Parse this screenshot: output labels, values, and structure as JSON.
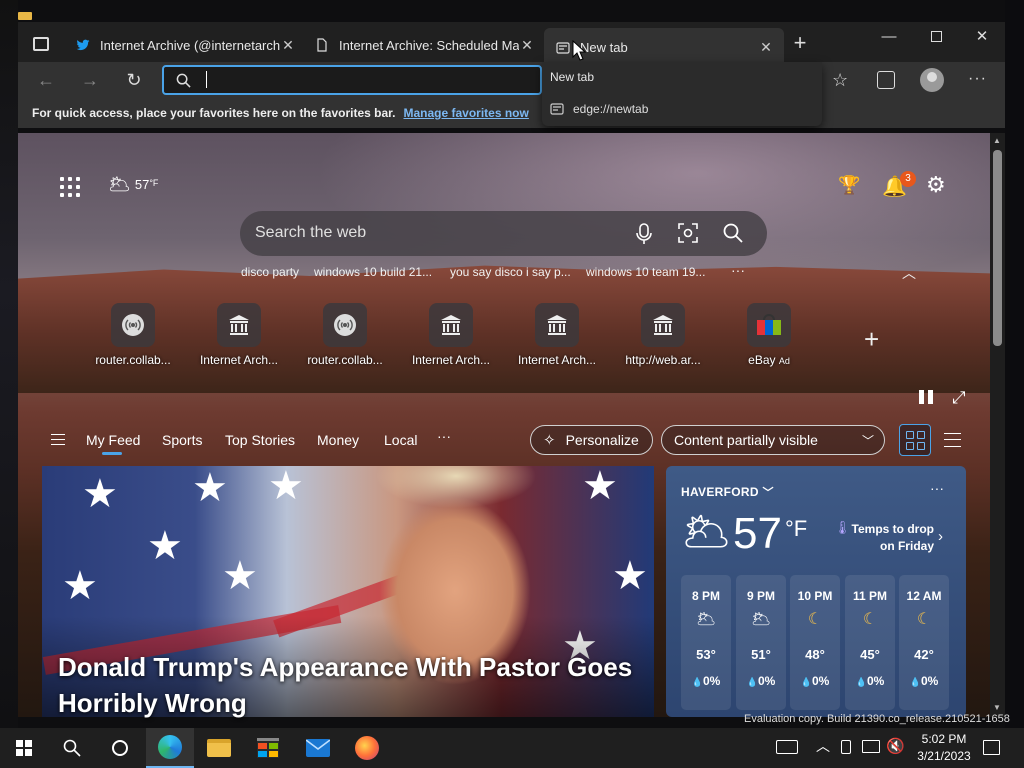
{
  "browser": {
    "tabs": [
      {
        "title": "Internet Archive (@internetarchive",
        "icon": "twitter-icon",
        "active": false
      },
      {
        "title": "Internet Archive: Scheduled Main",
        "icon": "document-icon",
        "active": false
      },
      {
        "title": "New tab",
        "icon": "newtab-icon",
        "active": true
      }
    ],
    "address": {
      "value": "",
      "placeholder": ""
    },
    "favorites_bar": {
      "text": "For quick access, place your favorites here on the favorites bar.",
      "link": "Manage favorites now"
    },
    "dropdown": {
      "title": "New tab",
      "item": "edge://newtab"
    }
  },
  "newtab": {
    "weather_temp": "57",
    "weather_unit": "°F",
    "notifications": "3",
    "search_placeholder": "Search the web",
    "suggestions": [
      "disco party",
      "windows 10 build 21...",
      "you say disco i say p...",
      "windows 10 team 19..."
    ],
    "more": "···",
    "tiles": [
      {
        "label": "router.collab...",
        "icon": "router-icon"
      },
      {
        "label": "Internet Arch...",
        "icon": "archive-icon"
      },
      {
        "label": "router.collab...",
        "icon": "router-icon"
      },
      {
        "label": "Internet Arch...",
        "icon": "archive-icon"
      },
      {
        "label": "Internet Arch...",
        "icon": "archive-icon"
      },
      {
        "label": "http://web.ar...",
        "icon": "archive-icon"
      },
      {
        "label": "eBay",
        "ad": "Ad",
        "icon": "ebay-icon"
      }
    ],
    "feed_tabs": [
      "My Feed",
      "Sports",
      "Top Stories",
      "Money",
      "Local"
    ],
    "personalize": "Personalize",
    "content_visibility": "Content partially visible",
    "hero_headline": "Donald Trump's Appearance With Pastor Goes Horribly Wrong",
    "weather_card": {
      "location": "HAVERFORD",
      "temp": "57",
      "unit": "°F",
      "note": "Temps to drop on Friday",
      "hours": [
        {
          "time": "8 PM",
          "temp": "53°",
          "precip": "0%",
          "icon": "partly-cloudy-night-icon"
        },
        {
          "time": "9 PM",
          "temp": "51°",
          "precip": "0%",
          "icon": "partly-cloudy-night-icon"
        },
        {
          "time": "10 PM",
          "temp": "48°",
          "precip": "0%",
          "icon": "moon-icon"
        },
        {
          "time": "11 PM",
          "temp": "45°",
          "precip": "0%",
          "icon": "moon-icon"
        },
        {
          "time": "12 AM",
          "temp": "42°",
          "precip": "0%",
          "icon": "moon-icon"
        }
      ]
    }
  },
  "watermark": "Evaluation copy. Build 21390.co_release.210521-1658",
  "taskbar": {
    "time": "5:02 PM",
    "date": "3/21/2023"
  },
  "colors": {
    "accent": "#4aa3e8",
    "link": "#7cb8f2",
    "badge": "#e8581c"
  }
}
